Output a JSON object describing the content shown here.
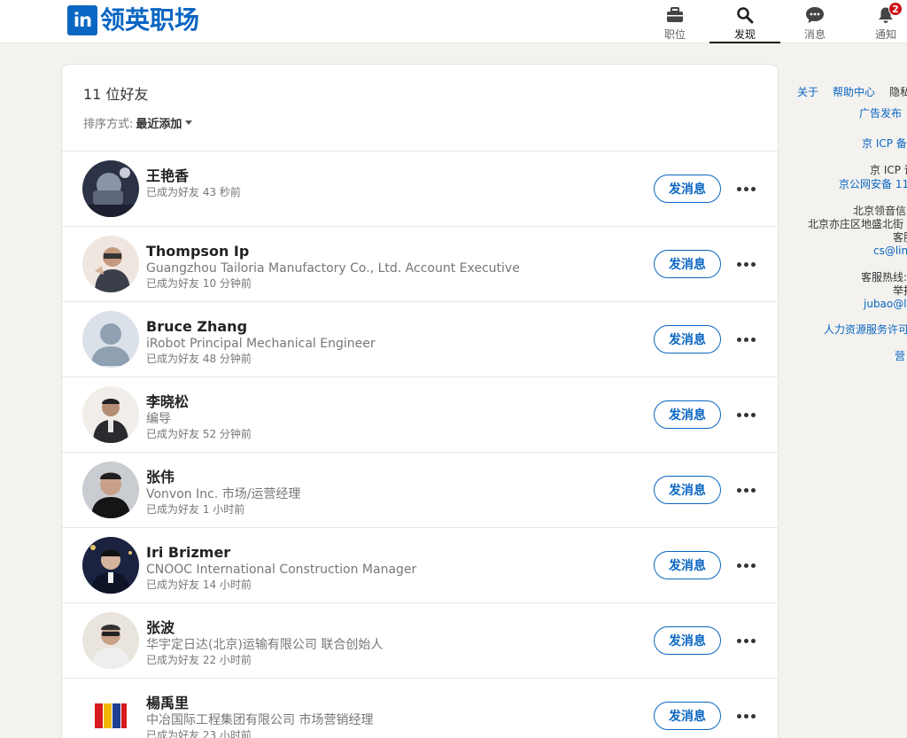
{
  "brand": {
    "logo_mark": "in",
    "name": "领英职场",
    "accent": "#0a66c2"
  },
  "nav": [
    {
      "label": "职位",
      "icon": "briefcase-icon",
      "active": false
    },
    {
      "label": "发现",
      "icon": "search-icon",
      "active": true
    },
    {
      "label": "消息",
      "icon": "message-icon",
      "active": false
    },
    {
      "label": "通知",
      "icon": "bell-icon",
      "active": false,
      "badge": "2"
    }
  ],
  "connections": {
    "count_title": "11 位好友",
    "sort_label": "排序方式:",
    "sort_value": "最近添加",
    "message_label": "发消息",
    "items": [
      {
        "name": "王艳香",
        "headline": "",
        "time": "已成为好友 43 秒前"
      },
      {
        "name": "Thompson Ip",
        "headline": "Guangzhou Tailoria Manufactory Co., Ltd. Account Executive",
        "time": "已成为好友 10 分钟前"
      },
      {
        "name": "Bruce Zhang",
        "headline": "iRobot Principal Mechanical Engineer",
        "time": "已成为好友 48 分钟前"
      },
      {
        "name": "李晓松",
        "headline": "编导",
        "time": "已成为好友 52 分钟前"
      },
      {
        "name": "张伟",
        "headline": "Vonvon Inc. 市场/运营经理",
        "time": "已成为好友 1 小时前"
      },
      {
        "name": "Iri Brizmer",
        "headline": "CNOOC International Construction Manager",
        "time": "已成为好友 14 小时前"
      },
      {
        "name": "张波",
        "headline": "华宇定日达(北京)运输有限公司 联合创始人",
        "time": "已成为好友 22 小时前"
      },
      {
        "name": "楊禹里",
        "headline": "中冶国际工程集团有限公司 市场营销经理",
        "time": "已成为好友 23 小时前"
      }
    ]
  },
  "footer": {
    "about": "关于",
    "help": "帮助中心",
    "privacy": "隐私",
    "ads": "广告发布",
    "icp1": "京 ICP 备",
    "icp2": "京 ICP 证",
    "police": "京公网安备 11",
    "company": "北京领音信息",
    "address": "北京亦庄区地盛北街",
    "service": "客服",
    "email1": "cs@lin",
    "hotline": "客服热线:",
    "report": "举报",
    "email2": "jubao@l",
    "hr": "人力资源服务许可",
    "biz": "营"
  }
}
